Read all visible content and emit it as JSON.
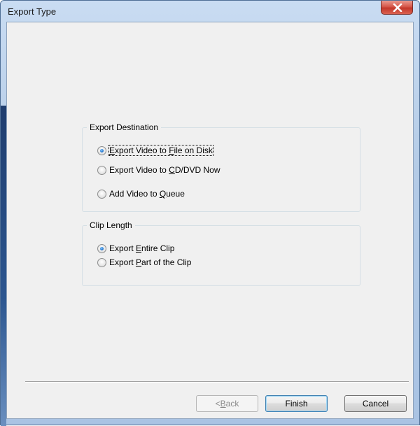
{
  "window": {
    "title": "Export Type",
    "close_icon": "close-icon"
  },
  "export_destination": {
    "legend": "Export Destination",
    "options": [
      {
        "pre": "",
        "u": "E",
        "post": "xport Video to ",
        "u2": "F",
        "post2": "ile on Disk",
        "selected": true
      },
      {
        "pre": "Export Video to ",
        "u": "C",
        "post": "D/DVD Now",
        "selected": false
      },
      {
        "pre": "Add Video to ",
        "u": "Q",
        "post": "ueue",
        "selected": false
      }
    ]
  },
  "clip_length": {
    "legend": "Clip Length",
    "options": [
      {
        "pre": "Export ",
        "u": "E",
        "post": "ntire Clip",
        "selected": true
      },
      {
        "pre": "Export ",
        "u": "P",
        "post": "art of the Clip",
        "selected": false
      }
    ]
  },
  "buttons": {
    "back": {
      "pre": "< ",
      "u": "B",
      "post": "ack",
      "enabled": false
    },
    "finish": "Finish",
    "cancel": "Cancel"
  }
}
